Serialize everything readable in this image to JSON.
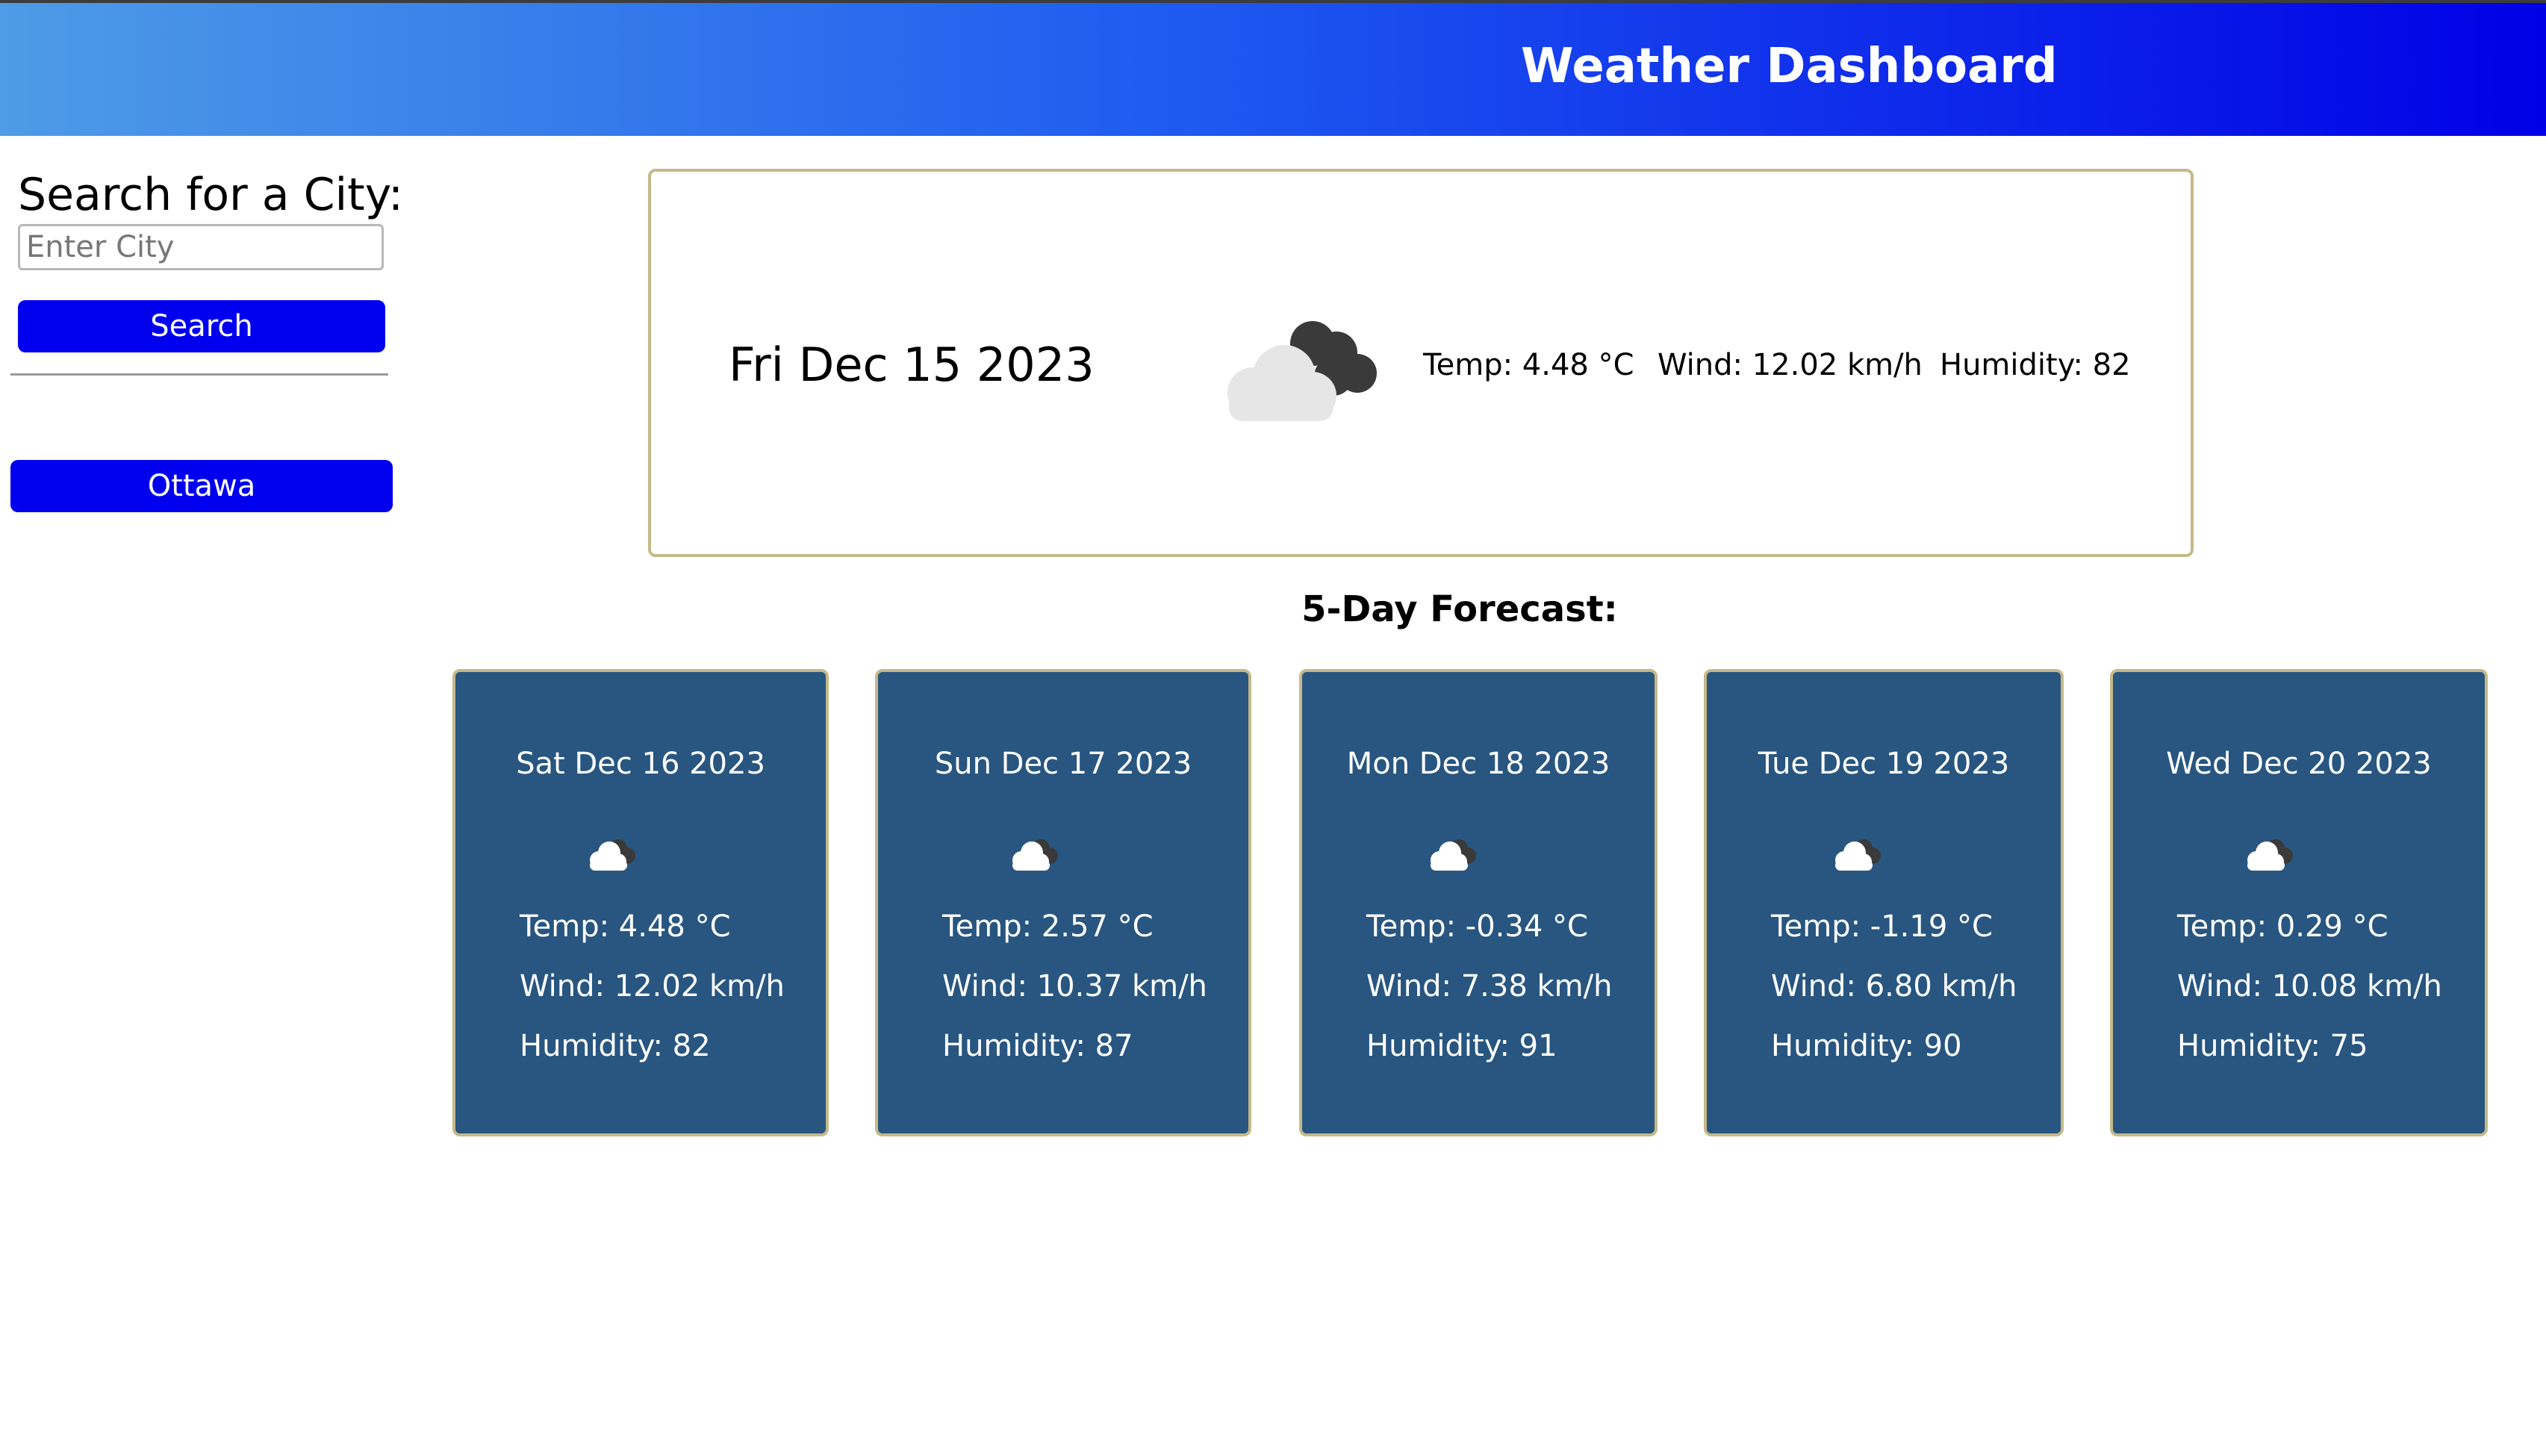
{
  "header": {
    "title": "Weather Dashboard"
  },
  "sidebar": {
    "search_heading": "Search for a City:",
    "search_input": {
      "value": "",
      "placeholder": "Enter City"
    },
    "search_button_label": "Search",
    "history": [
      {
        "label": "Ottawa"
      }
    ]
  },
  "current": {
    "date": "Fri Dec 15 2023",
    "icon": "cloud-night-icon",
    "temp": "Temp: 4.48 °C",
    "wind": "Wind: 12.02 km/h",
    "humidity": "Humidity: 82"
  },
  "forecast": {
    "heading": "5-Day Forecast:",
    "days": [
      {
        "date": "Sat Dec 16 2023",
        "icon": "cloud-night-icon",
        "temp": "Temp: 4.48 °C",
        "wind": "Wind: 12.02 km/h",
        "humidity": "Humidity: 82"
      },
      {
        "date": "Sun Dec 17 2023",
        "icon": "cloud-night-icon",
        "temp": "Temp: 2.57 °C",
        "wind": "Wind: 10.37 km/h",
        "humidity": "Humidity: 87"
      },
      {
        "date": "Mon Dec 18 2023",
        "icon": "cloud-night-icon",
        "temp": "Temp: -0.34 °C",
        "wind": "Wind: 7.38 km/h",
        "humidity": "Humidity: 91"
      },
      {
        "date": "Tue Dec 19 2023",
        "icon": "cloud-night-icon",
        "temp": "Temp: -1.19 °C",
        "wind": "Wind: 6.80 km/h",
        "humidity": "Humidity: 90"
      },
      {
        "date": "Wed Dec 20 2023",
        "icon": "cloud-night-icon",
        "temp": "Temp: 0.29 °C",
        "wind": "Wind: 10.08 km/h",
        "humidity": "Humidity: 75"
      }
    ]
  },
  "colors": {
    "header_gradient_start": "#4e9be6",
    "header_gradient_end": "#0000e6",
    "button": "#0000ee",
    "forecast_card": "#285680",
    "card_border": "#c5b98a"
  }
}
